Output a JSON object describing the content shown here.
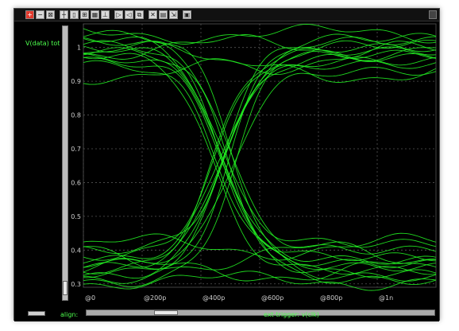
{
  "window": {
    "toolbar_icons": [
      "zoom-in-icon",
      "zoom-out-icon",
      "zoom-fit-icon",
      "cursor-icon",
      "marker-icon",
      "measure-icon",
      "grid-icon",
      "pan-icon",
      "forward-icon",
      "back-icon",
      "copy-icon",
      "delete-icon",
      "print-icon",
      "export-icon",
      "settings-icon"
    ],
    "trace_label": "V(data) tot",
    "align_label": "align:",
    "trigger_label": "ext-trigger: v(clk)"
  },
  "colors": {
    "background": "#000000",
    "trace": "#22ee22",
    "axis_text": "#cfcfcf",
    "grid": "#555555"
  },
  "chart_data": {
    "type": "line",
    "title": "",
    "xlabel": "",
    "ylabel": "V(data) tot",
    "x_unit": "s",
    "xlim": [
      0,
      1.2e-09
    ],
    "ylim": [
      0.29,
      1.07
    ],
    "x_ticks": [
      0,
      2e-10,
      4e-10,
      6e-10,
      8e-10,
      1e-09
    ],
    "x_tick_labels": [
      "@0",
      "@200p",
      "@400p",
      "@600p",
      "@800p",
      "@1n"
    ],
    "y_ticks": [
      0.3,
      0.4,
      0.5,
      0.6,
      0.7,
      0.8,
      0.9,
      1.0
    ],
    "y_tick_labels": [
      "0.3",
      "0.4",
      "0.5",
      "0.6",
      "0.7",
      "0.8",
      "0.9",
      "1"
    ],
    "grid": true,
    "legend": "none",
    "eye_crossing": {
      "x": 4.8e-10,
      "y": 0.66
    },
    "series": [
      {
        "kind": "fall",
        "start": 1.01,
        "end": 0.35,
        "t50": 4.7e-10
      },
      {
        "kind": "fall",
        "start": 0.97,
        "end": 0.33,
        "t50": 4.85e-10
      },
      {
        "kind": "fall",
        "start": 1.03,
        "end": 0.38,
        "t50": 4.55e-10
      },
      {
        "kind": "fall",
        "start": 0.99,
        "end": 0.31,
        "t50": 5e-10
      },
      {
        "kind": "fall",
        "start": 0.95,
        "end": 0.36,
        "t50": 4.6e-10
      },
      {
        "kind": "fall",
        "start": 1.02,
        "end": 0.4,
        "t50": 4.9e-10
      },
      {
        "kind": "fall",
        "start": 0.98,
        "end": 0.34,
        "t50": 4.4e-10
      },
      {
        "kind": "fall",
        "start": 1.04,
        "end": 0.32,
        "t50": 5.1e-10
      },
      {
        "kind": "fall",
        "start": 0.96,
        "end": 0.37,
        "t50": 4.75e-10
      },
      {
        "kind": "fall",
        "start": 1.0,
        "end": 0.42,
        "t50": 4.65e-10
      },
      {
        "kind": "rise",
        "start": 0.33,
        "end": 1.0,
        "t50": 4.8e-10
      },
      {
        "kind": "rise",
        "start": 0.35,
        "end": 0.96,
        "t50": 4.65e-10
      },
      {
        "kind": "rise",
        "start": 0.31,
        "end": 1.03,
        "t50": 4.95e-10
      },
      {
        "kind": "rise",
        "start": 0.38,
        "end": 0.98,
        "t50": 4.5e-10
      },
      {
        "kind": "rise",
        "start": 0.36,
        "end": 0.93,
        "t50": 5.05e-10
      },
      {
        "kind": "rise",
        "start": 0.32,
        "end": 1.02,
        "t50": 4.7e-10
      },
      {
        "kind": "rise",
        "start": 0.4,
        "end": 0.97,
        "t50": 4.85e-10
      },
      {
        "kind": "rise",
        "start": 0.34,
        "end": 0.99,
        "t50": 4.4e-10
      },
      {
        "kind": "rise",
        "start": 0.37,
        "end": 0.95,
        "t50": 4.6e-10
      },
      {
        "kind": "rise",
        "start": 0.3,
        "end": 1.01,
        "t50": 5.15e-10
      },
      {
        "kind": "high",
        "level": 1.0,
        "wiggle": 0.03
      },
      {
        "kind": "high",
        "level": 0.97,
        "wiggle": 0.04
      },
      {
        "kind": "high",
        "level": 1.04,
        "wiggle": 0.02
      },
      {
        "kind": "high",
        "level": 0.93,
        "wiggle": 0.03
      },
      {
        "kind": "low",
        "level": 0.34,
        "wiggle": 0.03
      },
      {
        "kind": "low",
        "level": 0.38,
        "wiggle": 0.04
      },
      {
        "kind": "low",
        "level": 0.31,
        "wiggle": 0.02
      },
      {
        "kind": "low",
        "level": 0.41,
        "wiggle": 0.03
      }
    ]
  }
}
